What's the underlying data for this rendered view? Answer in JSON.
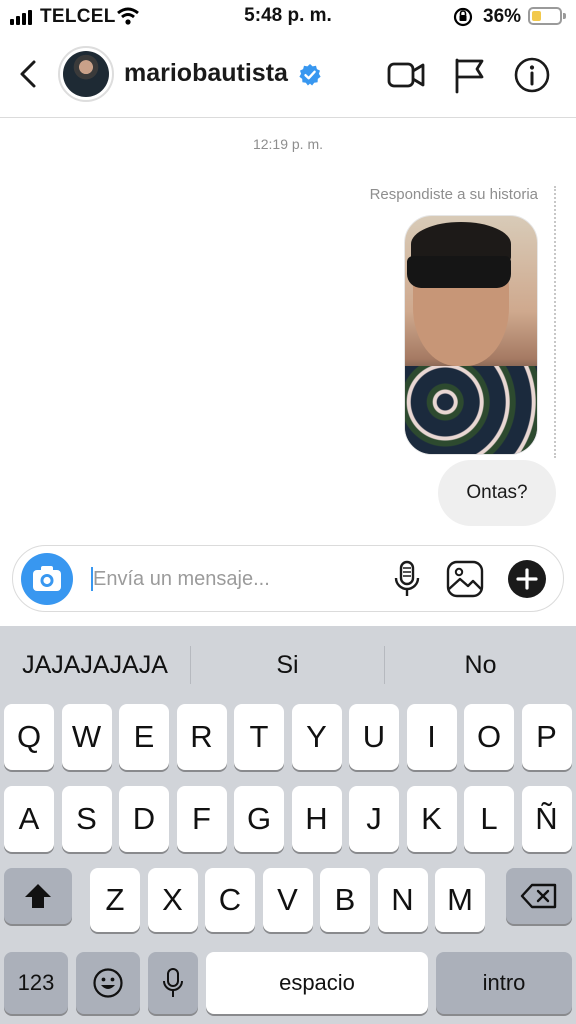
{
  "status_bar": {
    "carrier": "TELCEL",
    "time": "5:48 p. m.",
    "battery_pct": "36%",
    "battery_level": 0.36,
    "battery_color": "#f2c94c"
  },
  "header": {
    "username": "mariobautista",
    "verified_color": "#3897f0",
    "icons": [
      "chevron-left-icon",
      "video-camera-icon",
      "flag-icon",
      "info-icon"
    ]
  },
  "thread": {
    "timestamp": "12:19 p. m.",
    "story_note": "Respondiste a su historia",
    "message": "Ontas?"
  },
  "composer": {
    "placeholder": "Envía un mensaje...",
    "accent": "#3897f0",
    "icons": [
      "camera-icon",
      "microphone-icon",
      "gallery-icon",
      "plus-icon"
    ]
  },
  "keyboard": {
    "suggestions": [
      "JAJAJAJAJA",
      "Si",
      "No"
    ],
    "row1": [
      "Q",
      "W",
      "E",
      "R",
      "T",
      "Y",
      "U",
      "I",
      "O",
      "P"
    ],
    "row2": [
      "A",
      "S",
      "D",
      "F",
      "G",
      "H",
      "J",
      "K",
      "L",
      "Ñ"
    ],
    "row3": [
      "Z",
      "X",
      "C",
      "V",
      "B",
      "N",
      "M"
    ],
    "numbers_key": "123",
    "space_key": "espacio",
    "return_key": "intro"
  }
}
